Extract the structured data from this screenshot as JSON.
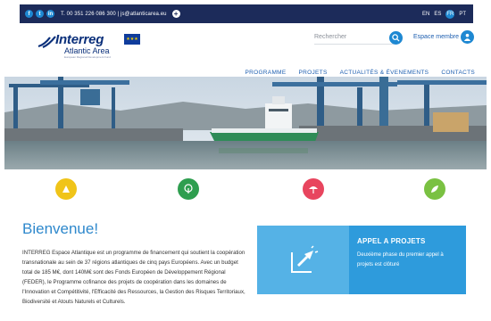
{
  "topbar": {
    "social": [
      "f",
      "t",
      "in"
    ],
    "contact": "T. 00 351 226 086 300 | js@atlanticarea.eu",
    "languages": [
      "EN",
      "ES",
      "FR",
      "PT"
    ],
    "active_language": "FR"
  },
  "header": {
    "logo_brand": "Interreg",
    "logo_sub": "Atlantic Area",
    "logo_tagline": "European Regional Development Fund",
    "search_placeholder": "Rechercher",
    "member_label": "Espace membre"
  },
  "nav": {
    "items": [
      "PROGRAMME",
      "PROJETS",
      "ACTUALITÉS & ÉVENEMENTS",
      "CONTACTS"
    ]
  },
  "icons": [
    {
      "name": "innovation",
      "color": "#f0c419"
    },
    {
      "name": "resources",
      "color": "#2e9e4f"
    },
    {
      "name": "risks",
      "color": "#e8455e"
    },
    {
      "name": "biodiversity",
      "color": "#7ac142"
    }
  ],
  "welcome": {
    "title": "Bienvenue!",
    "body": "INTERREG Espace Atlantique est un programme de financement qui soutient la coopération transnationale au sein de 37 régions atlantiques de cinq pays Européens. Avec un budget total de 185 M€, dont 140M€ sont des Fonds Européen de Développement Régional (FEDER), le Programme cofinance des projets de coopération dans les domaines de l'Innovation et Compétitivité, l'Efficacité des Ressources, la Gestion des Risques Territoriaux, Biodiversité et Atouts Naturels et Culturels."
  },
  "card": {
    "title": "APPEL A PROJETS",
    "text": "Deuxième phase du premier appel à projets est clôturé"
  },
  "colors": {
    "topbar": "#1c2b5a",
    "accent": "#1e88d2",
    "card": "#2e9bdc",
    "title": "#2e88cc"
  }
}
